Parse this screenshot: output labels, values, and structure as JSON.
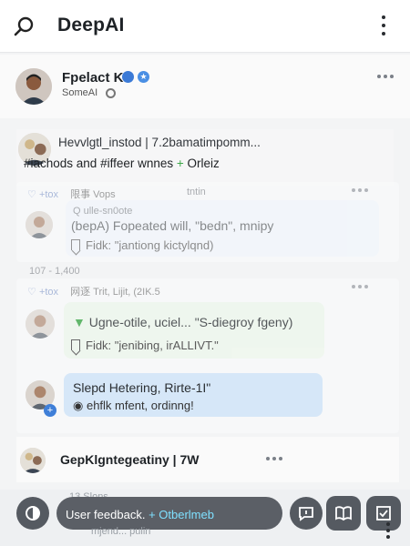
{
  "app": {
    "title": "DeepAI"
  },
  "profile": {
    "name": "Fpelact K",
    "subtitle": "SomeAI"
  },
  "post": {
    "title": "Hevvlgtl_instod | 7.2bamatimpomm...",
    "line": "#iachods and #iffeer wnnes",
    "plus": "+",
    "tag": "Orleiz"
  },
  "thread1": {
    "meta_label": "+tox",
    "meta_text": "限事 Vops",
    "meta_right": "tntin",
    "bubble_meta": "Q ulle-sn0ote",
    "bubble_text": "(bepA) Fopeated will, \"bedn\", mnipy",
    "bubble_sub": "Fidk: \"jantiong kictylqnd)",
    "stats": "107 - 1,400",
    "meta2_label": "+tox",
    "meta2_text": "网逐 Trit, Lijit, (2IK.5",
    "bubble2_text": "Ugne-otile, uciel... \"S-diegroy fgeny)",
    "bubble2_sub": "Fidk: \"jenibing, irALLIVT.\"",
    "bubble3_text": "Slepd Hetering, Rirte-1I\"",
    "bubble3_sub": "ehflk mfent, ordinng!"
  },
  "reply": {
    "name": "GepKlgntegeatiny | 7W"
  },
  "bottom": {
    "ghost1": "13 Slons",
    "feedback": "User feedback.",
    "plus": "+",
    "accent": "Otberlmeb",
    "ghost2": "mjend... pulin"
  },
  "colors": {
    "bubble_blue": "#eef4fc",
    "bubble_green": "#edf6ec",
    "bubble_highlight": "#d6e7f8",
    "accent_green": "#3ea84a",
    "accent_cyan": "#7fe0ff",
    "meta_blue": "#6a85c0"
  },
  "icons": [
    "search-icon",
    "kebab-icon",
    "verified-icon",
    "settings-icon",
    "heart-icon",
    "bookmark-icon",
    "message-icon",
    "book-icon",
    "checkbox-icon",
    "globe-icon"
  ]
}
